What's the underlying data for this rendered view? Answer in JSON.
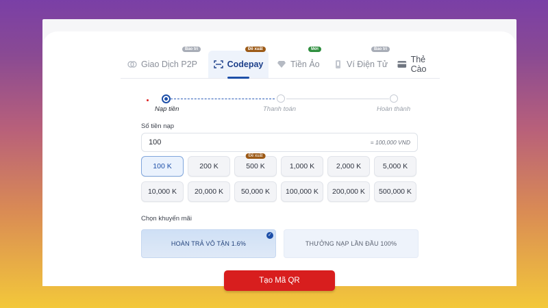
{
  "tabs": [
    {
      "label": "Giao Dịch P2P",
      "badge": "Bảo trì",
      "icon": "p2p-coins-icon"
    },
    {
      "label": "Codepay",
      "badge": "Đề xuất",
      "icon": "qr-scan-icon"
    },
    {
      "label": "Tiền Ảo",
      "badge": "Mới",
      "icon": "diamond-icon"
    },
    {
      "label": "Ví Điện Tử",
      "badge": "Bảo trì",
      "icon": "phone-wallet-icon"
    },
    {
      "label": "Thẻ Cào",
      "badge": "",
      "icon": "card-icon"
    }
  ],
  "stepper": {
    "steps": [
      "Nạp tiền",
      "Thanh toán",
      "Hoàn thành"
    ]
  },
  "amount": {
    "label": "Số tiền nạp",
    "value": "100",
    "conversion": "= 100,000 VND"
  },
  "presets": [
    {
      "label": "100 K",
      "badge": ""
    },
    {
      "label": "200 K",
      "badge": ""
    },
    {
      "label": "500 K",
      "badge": "Đề xuất"
    },
    {
      "label": "1,000 K",
      "badge": ""
    },
    {
      "label": "2,000 K",
      "badge": ""
    },
    {
      "label": "5,000 K",
      "badge": ""
    },
    {
      "label": "10,000 K",
      "badge": ""
    },
    {
      "label": "20,000 K",
      "badge": ""
    },
    {
      "label": "50,000 K",
      "badge": ""
    },
    {
      "label": "100,000 K",
      "badge": ""
    },
    {
      "label": "200,000 K",
      "badge": ""
    },
    {
      "label": "500,000 K",
      "badge": ""
    }
  ],
  "promo": {
    "label": "Chọn khuyến mãi",
    "options": [
      "HOÀN TRẢ VÔ TẬN 1.6%",
      "THƯỞNG NẠP LẦN ĐẦU 100%"
    ]
  },
  "cta": {
    "label": "Tạo Mã QR"
  },
  "colors": {
    "primary": "#1d4fa8",
    "cta": "#d81e1e",
    "badge_recommend": "#9c5a17",
    "badge_new": "#2f8f3f",
    "badge_maintenance": "#a8adb7"
  }
}
